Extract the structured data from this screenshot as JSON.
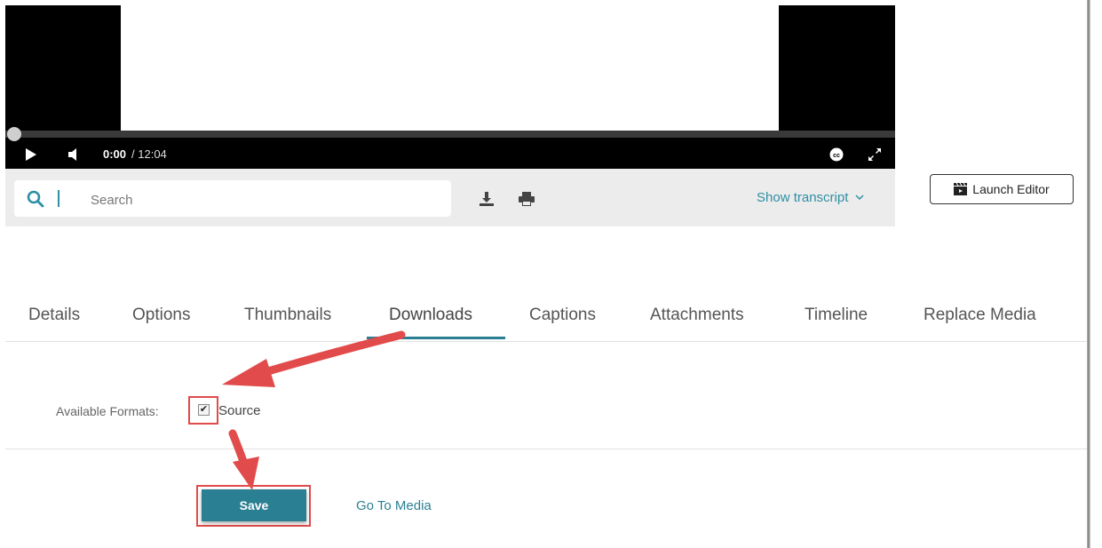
{
  "player": {
    "current_time": "0:00",
    "duration": "/ 12:04",
    "progress_fraction": 0.0
  },
  "toolbar": {
    "search_placeholder": "Search",
    "show_transcript": "Show transcript",
    "launch_editor": "Launch Editor"
  },
  "tabs": [
    "Details",
    "Options",
    "Thumbnails",
    "Downloads",
    "Captions",
    "Attachments",
    "Timeline",
    "Replace Media"
  ],
  "active_tab": "Downloads",
  "downloads": {
    "formats_label": "Available Formats:",
    "source_label": "Source",
    "source_checked": true
  },
  "actions": {
    "save": "Save",
    "go_to_media": "Go To Media"
  },
  "colors": {
    "accent": "#2b7f93",
    "annotation_red": "#e14b4b"
  }
}
